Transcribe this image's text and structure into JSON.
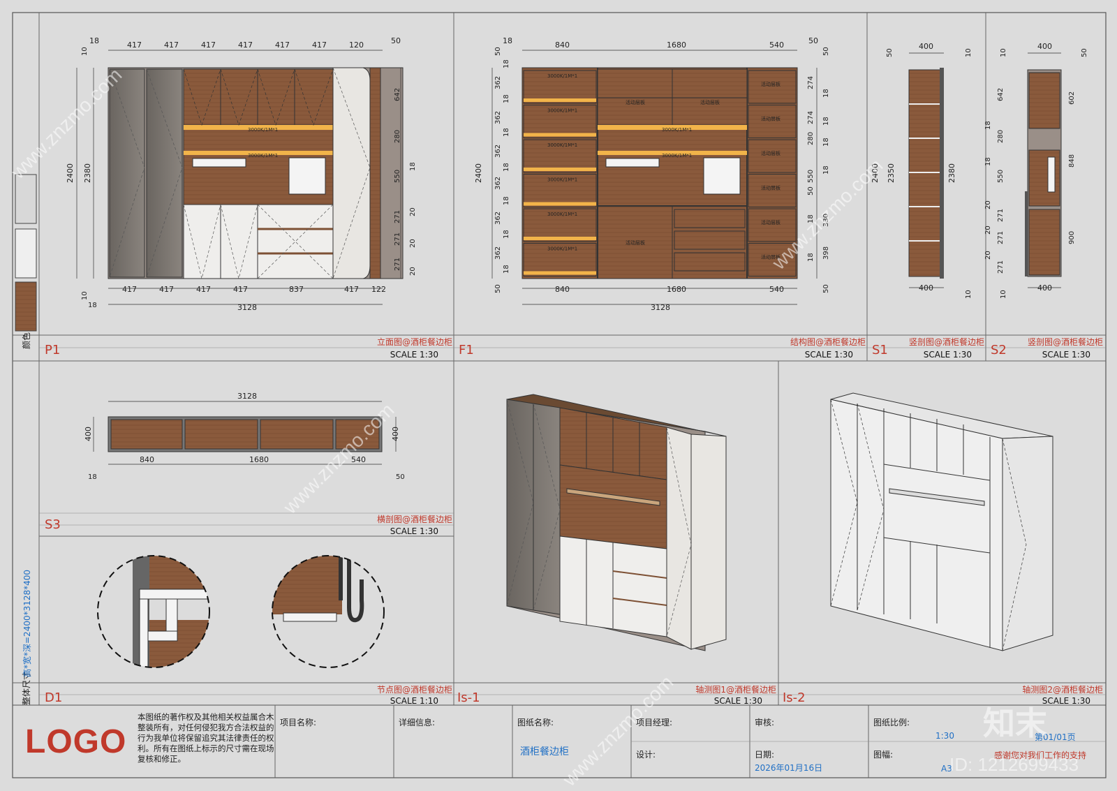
{
  "views": {
    "p1": {
      "code": "P1",
      "title": "立面图@酒柜餐边柜",
      "scale": "SCALE 1:30"
    },
    "f1": {
      "code": "F1",
      "title": "结构图@酒柜餐边柜",
      "scale": "SCALE 1:30"
    },
    "s1": {
      "code": "S1",
      "title": "竖剖图@酒柜餐边柜",
      "scale": "SCALE 1:30"
    },
    "s2": {
      "code": "S2",
      "title": "竖剖图@酒柜餐边柜",
      "scale": "SCALE 1:30"
    },
    "s3": {
      "code": "S3",
      "title": "横剖图@酒柜餐边柜",
      "scale": "SCALE 1:30"
    },
    "d1": {
      "code": "D1",
      "title": "节点图@酒柜餐边柜",
      "scale": "SCALE 1:10"
    },
    "is1": {
      "code": "Is-1",
      "title": "轴测图1@酒柜餐边柜",
      "scale": "SCALE 1:30"
    },
    "is2": {
      "code": "Is-2",
      "title": "轴测图2@酒柜餐边柜",
      "scale": "SCALE 1:30"
    }
  },
  "sidebar": {
    "color_label": "颜色",
    "size_label": "整体尺寸",
    "size_value": "高*宽*深=2400*3128*400"
  },
  "p1_dims": {
    "top": [
      "18",
      "417",
      "417",
      "417",
      "417",
      "417",
      "417",
      "120",
      "50"
    ],
    "bottom": [
      "417",
      "417",
      "417",
      "417",
      "837",
      "417",
      "122"
    ],
    "total": "3128",
    "left": [
      "10",
      "2400",
      "2380",
      "10",
      "18"
    ],
    "right": [
      "642",
      "280",
      "550",
      "18",
      "271",
      "20",
      "271",
      "20",
      "271",
      "20",
      "50",
      "10"
    ],
    "lights": [
      "3000K/1M*1",
      "3000K/1M*1"
    ]
  },
  "f1_dims": {
    "top": [
      "18",
      "840",
      "1680",
      "540",
      "50"
    ],
    "bottom": [
      "840",
      "1680",
      "540"
    ],
    "total": "3128",
    "left": [
      "50",
      "18",
      "362",
      "18",
      "362",
      "18",
      "362",
      "18",
      "362",
      "18",
      "362",
      "18",
      "362",
      "18",
      "50",
      "2400"
    ],
    "right": [
      "50",
      "274",
      "18",
      "274",
      "18",
      "280",
      "18",
      "550",
      "18",
      "50",
      "330",
      "18",
      "398",
      "18",
      "50"
    ],
    "lights": [
      "3000K/1M*1",
      "3000K/1M*1",
      "3000K/1M*1",
      "3000K/1M*1",
      "3000K/1M*1",
      "3000K/1M*1",
      "3000K/1M*1",
      "3000K/1M*1"
    ],
    "shelf": "活动层板"
  },
  "s1_dims": {
    "top": "400",
    "bottom": "400",
    "left_a": "2400",
    "left_b": "2350",
    "right": "2380",
    "n50": "50",
    "n10": "10"
  },
  "s2_dims": {
    "top": "400",
    "bottom": "400",
    "left": [
      "642",
      "18",
      "280",
      "18",
      "550",
      "20",
      "271",
      "20",
      "271",
      "20",
      "271"
    ],
    "right": [
      "602",
      "848",
      "900"
    ],
    "n10": "10",
    "n50": "50"
  },
  "s3_dims": {
    "total": "3128",
    "depth": "400",
    "bottom": [
      "840",
      "1680",
      "540"
    ],
    "n18": "18",
    "n50": "50"
  },
  "title_block": {
    "logo": "LOGO",
    "copyright": "本图纸的著作权及其他相关权益属合木整装所有，对任何侵犯我方合法权益的行为我单位将保留追究其法律责任的权利。所有在图纸上标示的尺寸需在现场复核和修正。",
    "project_name_label": "项目名称:",
    "detail_label": "详细信息:",
    "drawing_name_label": "图纸名称:",
    "drawing_name": "酒柜餐边柜",
    "manager_label": "项目经理:",
    "design_label": "设计:",
    "review_label": "审核:",
    "date_label": "日期:",
    "date": "2026年01月16日",
    "scale_label": "图纸比例:",
    "scale": "1:30",
    "page": "第01/01页",
    "size_label": "图幅:",
    "size": "A3",
    "thanks": "感谢您对我们工作的支持"
  },
  "watermark": {
    "site": "www.znzmo.com",
    "brand": "知末",
    "id": "ID: 1212699433"
  }
}
